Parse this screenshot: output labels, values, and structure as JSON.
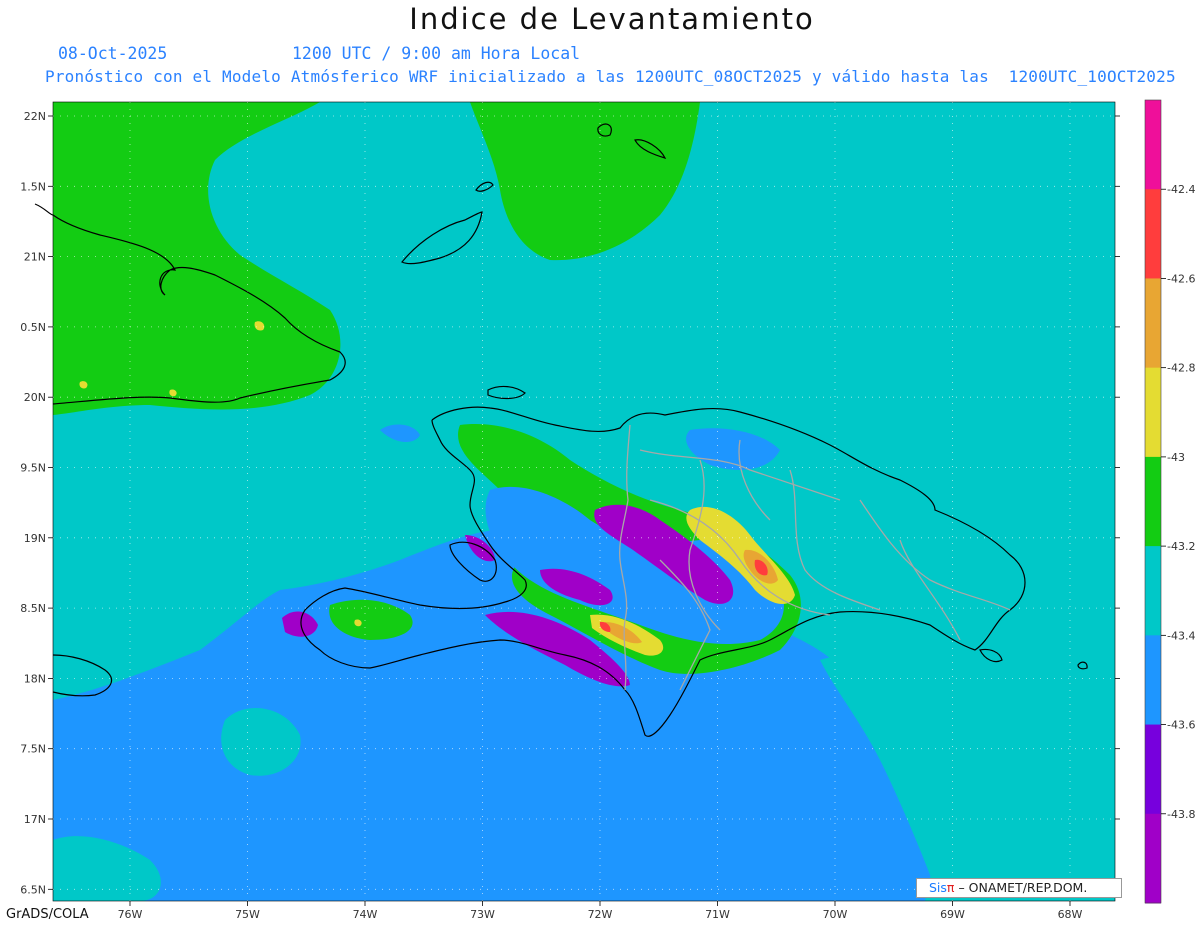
{
  "title": "Indice de Levantamiento",
  "date": "08-Oct-2025",
  "time": "1200 UTC / 9:00 am Hora Local",
  "description": "Pronóstico con el Modelo Atmósferico WRF inicializado a las 1200UTC_08OCT2025 y válido hasta las  1200UTC_10OCT2025",
  "credit": "GrADS/COLA",
  "logo": {
    "sis": "Sis",
    "pi": "π",
    "rest": "– ONAMET/REP.DOM."
  },
  "lat_labels": [
    "22N",
    "1.5N",
    "21N",
    "0.5N",
    "20N",
    "9.5N",
    "19N",
    "8.5N",
    "18N",
    "7.5N",
    "17N",
    "6.5N"
  ],
  "lon_labels": [
    "76W",
    "75W",
    "74W",
    "73W",
    "72W",
    "71W",
    "70W",
    "69W",
    "68W"
  ],
  "colorbar": {
    "labels": [
      "-42.4",
      "-42.6",
      "-42.8",
      "-43",
      "-43.2",
      "-43.4",
      "-43.6",
      "-43.8"
    ],
    "colors": [
      "#ef0f9a",
      "#ff3d3d",
      "#e8a633",
      "#e4dc32",
      "#13cc13",
      "#00c8c8",
      "#1e96ff",
      "#7700dd",
      "#a000c8"
    ]
  },
  "field_colors": {
    "background": "#00c8c8",
    "green": "#13cc13",
    "blue": "#1e96ff",
    "purple": "#a000c8",
    "violet": "#7700dd",
    "yellow": "#e4dc32",
    "orange": "#e8a633",
    "red": "#ff3d3d",
    "magenta": "#ef0f9a"
  }
}
